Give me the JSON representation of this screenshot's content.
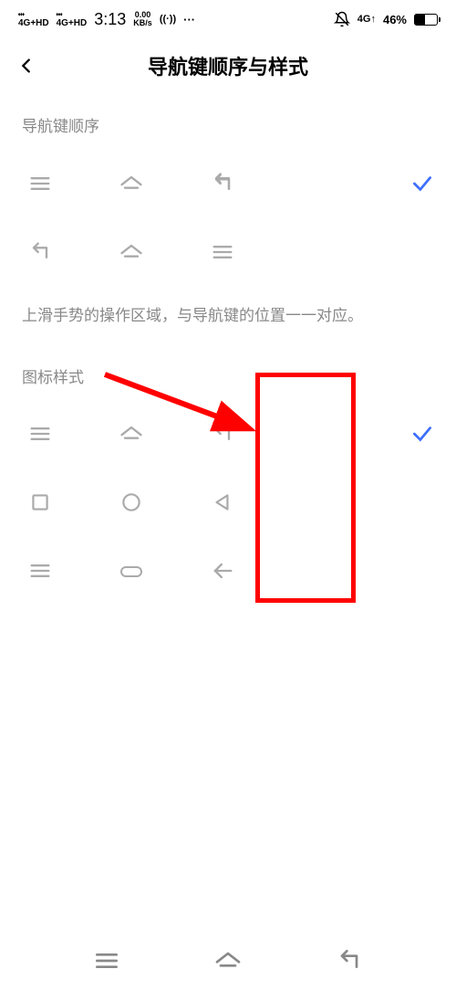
{
  "status_bar": {
    "signal1": "4G+HD",
    "signal2": "4G+HD",
    "time": "3:13",
    "kbps_top": "0.00",
    "kbps_bot": "KB/s",
    "wifi": "((·))",
    "dots": "···",
    "net_right": "4G↑",
    "battery_pct": "46%"
  },
  "header": {
    "title": "导航键顺序与样式"
  },
  "sections": {
    "order_label": "导航键顺序",
    "info_text": "上滑手势的操作区域，与导航键的位置一一对应。",
    "style_label": "图标样式"
  }
}
